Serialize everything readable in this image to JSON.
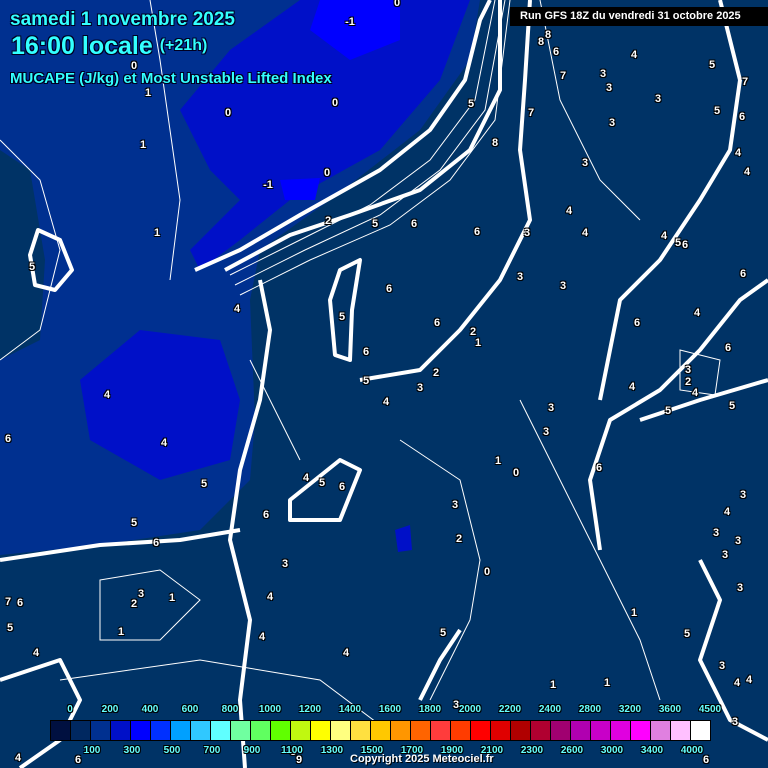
{
  "header": {
    "date": "samedi 1 novembre 2025",
    "time": "16:00 locale",
    "offset": "(+21h)",
    "subtitle": "MUCAPE (J/kg) et Most Unstable Lifted Index",
    "run": "Run GFS 18Z du vendredi 31 octobre 2025"
  },
  "legend": {
    "colors": [
      "#001040",
      "#002860",
      "#003090",
      "#0010c8",
      "#0000ff",
      "#0030ff",
      "#00a0ff",
      "#30c8ff",
      "#60ffff",
      "#70ffa0",
      "#60ff60",
      "#60ff00",
      "#c0f810",
      "#ffff00",
      "#ffff80",
      "#ffe040",
      "#ffc800",
      "#ff9600",
      "#ff6400",
      "#ff3c3c",
      "#ff3c00",
      "#ff0000",
      "#e00000",
      "#b00000",
      "#b00030",
      "#a00070",
      "#b000b0",
      "#c800c8",
      "#e000e0",
      "#ff00ff",
      "#e080e0",
      "#ffc0ff",
      "#ffffff"
    ],
    "top_labels": [
      "0",
      "200",
      "400",
      "600",
      "800",
      "1000",
      "1200",
      "1400",
      "1600",
      "1800",
      "2000",
      "2200",
      "2400",
      "2800",
      "3200",
      "3600",
      "4500"
    ],
    "bottom_labels": [
      "100",
      "300",
      "500",
      "700",
      "900",
      "1100",
      "1300",
      "1500",
      "1700",
      "1900",
      "2100",
      "2300",
      "2600",
      "3000",
      "3400",
      "4000"
    ]
  },
  "map": {
    "background": "#003366",
    "li_labels": [
      "-1",
      "0",
      "0",
      "1",
      "0",
      "0",
      "1",
      "0",
      "-1",
      "2",
      "1",
      "5",
      "4",
      "4",
      "4",
      "6",
      "5",
      "5",
      "6",
      "6",
      "6",
      "5",
      "4",
      "3",
      "3",
      "2",
      "1",
      "1",
      "4",
      "7",
      "6",
      "5",
      "4",
      "4",
      "4",
      "5",
      "0",
      "2",
      "3",
      "1",
      "0",
      "3",
      "2",
      "2",
      "1",
      "6",
      "6",
      "5",
      "5",
      "4",
      "6",
      "5",
      "6",
      "6",
      "3",
      "3",
      "3",
      "4",
      "4",
      "3",
      "3",
      "3",
      "3",
      "7",
      "7",
      "8",
      "8",
      "8",
      "6",
      "5",
      "4",
      "3",
      "5",
      "5",
      "7",
      "6",
      "4",
      "4",
      "4",
      "5",
      "6",
      "6",
      "6",
      "4",
      "6",
      "3",
      "2",
      "4",
      "5",
      "5",
      "4",
      "3",
      "3",
      "6",
      "3",
      "4",
      "3",
      "3",
      "3",
      "3",
      "1",
      "5",
      "3",
      "4",
      "4",
      "1",
      "1",
      "3",
      "3",
      "6",
      "6",
      "4",
      "9",
      "8"
    ]
  },
  "copyright": "Copyright 2025 Meteociel.fr"
}
